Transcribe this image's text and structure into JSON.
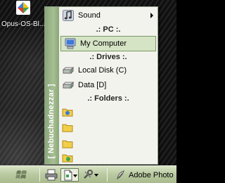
{
  "desktop": {
    "icon_label": "Opus-OS-Bl..."
  },
  "menu": {
    "sidebar_title": "[ Nebuchadnezzar ]",
    "items": {
      "sound": "Sound",
      "pc_header": ".: PC :.",
      "my_computer": "My Computer",
      "drives_header": ".: Drives :.",
      "local_disk": "Local Disk (C)",
      "data_drive": "Data [D]",
      "folders_header": ".: Folders :."
    }
  },
  "taskbar": {
    "app_label": "Adobe Photo"
  },
  "icons": [
    "windows-logo-icon",
    "music-note-icon",
    "computer-icon",
    "drive-icon",
    "folder-icon",
    "key-tool-icon",
    "printer-icon",
    "wrench-icon",
    "chevron-down-icon"
  ]
}
